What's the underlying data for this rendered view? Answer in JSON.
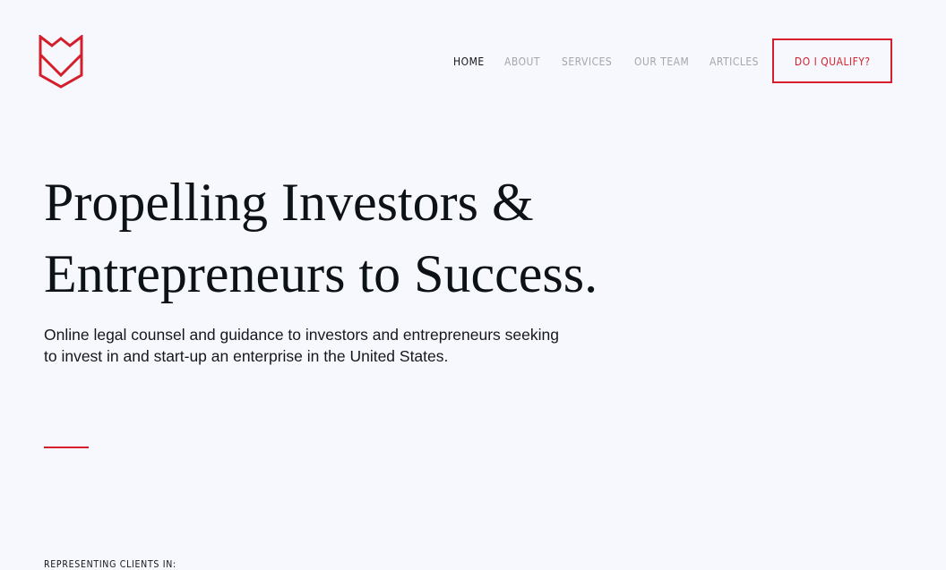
{
  "brand": {
    "logo_icon": "shield-crest-icon",
    "accent_color": "#d31f2b"
  },
  "nav": {
    "items": [
      {
        "label": "HOME",
        "active": true
      },
      {
        "label": "ABOUT",
        "active": false
      },
      {
        "label": "SERVICES",
        "active": false
      },
      {
        "label": "OUR TEAM",
        "active": false
      },
      {
        "label": "ARTICLES",
        "active": false
      }
    ],
    "cta_label": "DO I QUALIFY?"
  },
  "hero": {
    "title_lines": [
      "Propelling Investors &",
      "Entrepreneurs to Success."
    ],
    "subtitle_lines": [
      "Online legal counsel and guidance to investors and entrepreneurs seeking",
      "to invest in and start-up an enterprise in the United States."
    ]
  },
  "clients": {
    "label": "REPRESENTING CLIENTS IN:"
  }
}
